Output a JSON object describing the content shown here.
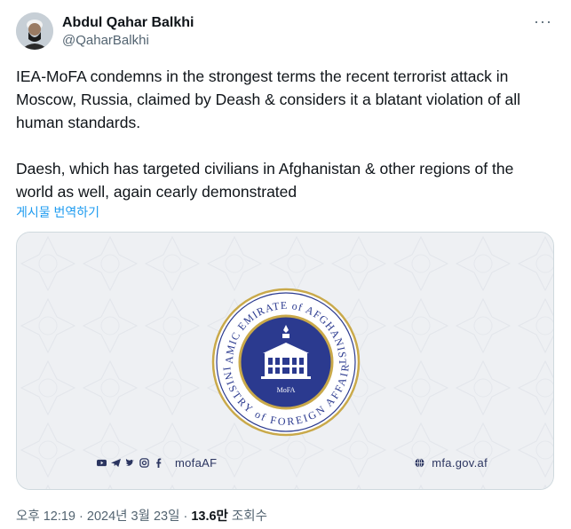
{
  "author": {
    "display_name": "Abdul Qahar Balkhi",
    "handle": "@QaharBalkhi"
  },
  "more_label": "···",
  "tweet": {
    "text": "IEA-MoFA condemns in the strongest terms the recent terrorist attack in Moscow, Russia, claimed by Deash & considers it a blatant violation of all human standards.\n\nDaesh, which has targeted civilians in Afghanistan & other regions of the world as well, again cearly demonstrated",
    "translate_label": "게시물 번역하기"
  },
  "media": {
    "seal_top_text": "ISLAMIC EMIRATE of AFGHANISTAN",
    "seal_bottom_text": "MINISTRY of FOREIGN AFFAIRS",
    "seal_center_label": "MoFA",
    "social_handle": "mofaAF",
    "website": "mfa.gov.af",
    "colors": {
      "navy": "#2b3a8f",
      "gold": "#c9a94a",
      "bg": "#eef0f3"
    }
  },
  "meta": {
    "time": "오후 12:19",
    "separator": " · ",
    "date": "2024년 3월 23일",
    "views_count": "13.6만",
    "views_label": " 조회수"
  }
}
